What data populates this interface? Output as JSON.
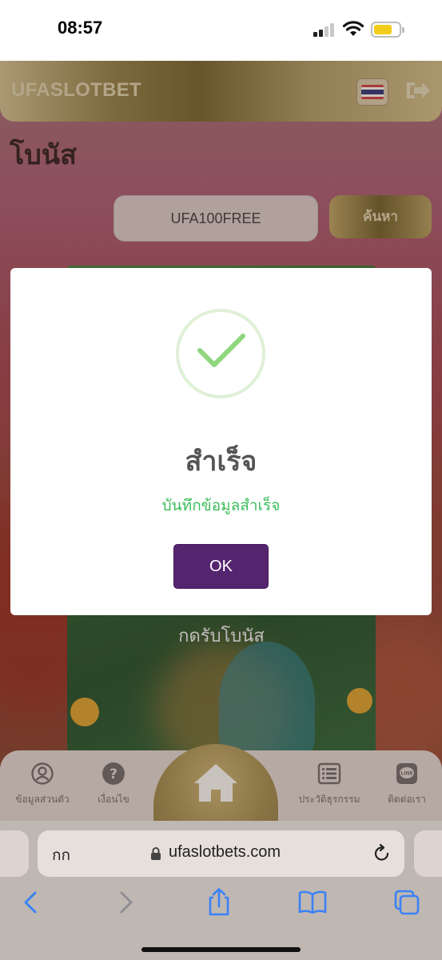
{
  "status_bar": {
    "time": "08:57"
  },
  "header": {
    "brand": "UFASLOTBET"
  },
  "page": {
    "title": "โบนัส",
    "promo_code_value": "UFA100FREE",
    "search_label": "ค้นหา",
    "banner_caption": "กดรับโบนัส"
  },
  "bottom_nav": {
    "items": [
      {
        "label": "ข้อมูลส่วนตัว",
        "icon": "user-circle-icon"
      },
      {
        "label": "เงื่อนไข",
        "icon": "question-circle-icon"
      },
      {
        "label": "ประวัติธุรกรรม",
        "icon": "list-icon"
      },
      {
        "label": "ติดต่อเรา",
        "icon": "line-chat-icon"
      }
    ],
    "center_icon": "home-icon"
  },
  "modal": {
    "title": "สำเร็จ",
    "message": "บันทึกข้อมูลสำเร็จ",
    "ok_label": "OK"
  },
  "browser": {
    "aa_label": "กก",
    "url": "ufaslotbets.com"
  },
  "colors": {
    "modal_message": "#3dbd5a",
    "ok_button": "#55246f",
    "success_check": "#8fd67f",
    "safari_tint": "#3b82f6"
  }
}
